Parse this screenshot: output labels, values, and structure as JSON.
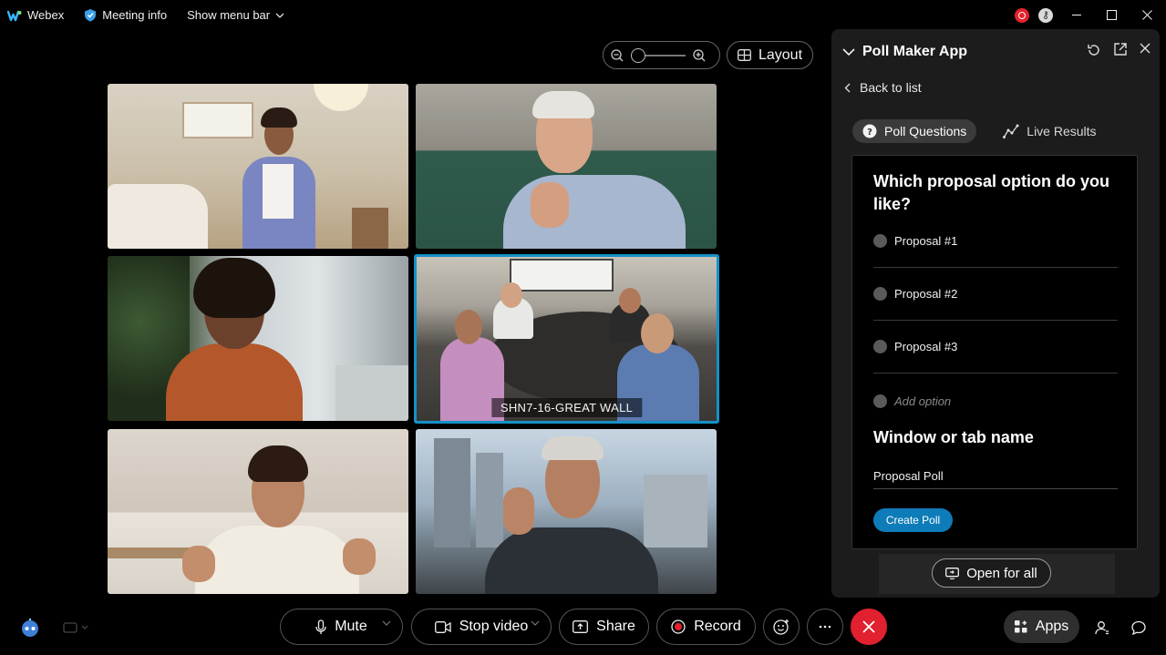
{
  "titlebar": {
    "app_name": "Webex",
    "meeting_info": "Meeting info",
    "show_menu_bar": "Show menu bar"
  },
  "toolbar": {
    "layout_label": "Layout",
    "zoom_level": 0
  },
  "videos": [
    {
      "id": "participant-1",
      "label": ""
    },
    {
      "id": "participant-2",
      "label": ""
    },
    {
      "id": "participant-3",
      "label": ""
    },
    {
      "id": "participant-4",
      "label": "SHN7-16-GREAT WALL"
    },
    {
      "id": "participant-5",
      "label": ""
    },
    {
      "id": "participant-6",
      "label": ""
    }
  ],
  "panel": {
    "title": "Poll Maker App",
    "back_link": "Back to list",
    "tabs": [
      {
        "label": "Poll Questions",
        "active": true
      },
      {
        "label": "Live Results",
        "active": false
      }
    ],
    "question": "Which proposal option do you like?",
    "options": [
      "Proposal #1",
      "Proposal #2",
      "Proposal #3"
    ],
    "add_option_placeholder": "Add option",
    "window_name_label": "Window or tab name",
    "window_name_value": "Proposal Poll",
    "create_button": "Create Poll",
    "open_for_all_button": "Open for all"
  },
  "controls": {
    "mute": "Mute",
    "stop_video": "Stop video",
    "share": "Share",
    "record": "Record",
    "apps": "Apps"
  },
  "colors": {
    "accent_blue": "#0e7cb8",
    "active_tile_border": "#1591c7",
    "end_call_red": "#e1212f",
    "record_red": "#e5222b"
  }
}
